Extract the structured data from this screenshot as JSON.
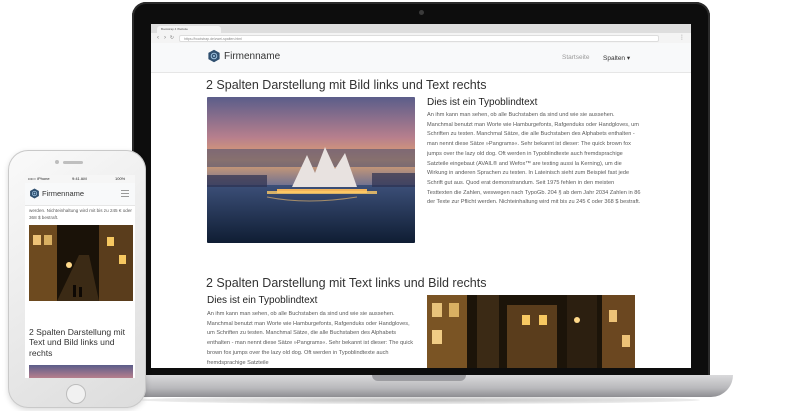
{
  "browser": {
    "tab_title": "Bootstrap 4 Website",
    "url": "https://bootstrap.de/zwei-spalten.html"
  },
  "site": {
    "brand": "Firmenname",
    "nav": [
      {
        "label": "Startseite"
      },
      {
        "label": "Spalten ▾"
      }
    ]
  },
  "section1": {
    "heading": "2 Spalten Darstellung mit Bild links und Text rechts",
    "subheading": "Dies ist ein Typoblindtext",
    "paragraph": "An ihm kann man sehen, ob alle Buchstaben da sind und wie sie aussehen. Manchmal benutzt man Worte wie Hamburgefonts, Rafgenduks oder Handgloves, um Schriften zu testen. Manchmal Sätze, die alle Buchstaben des Alphabets enthalten - man nennt diese Sätze »Pangrams«. Sehr bekannt ist dieser: The quick brown fox jumps over the lazy old dog. Oft werden in Typoblindtexte auch fremdsprachige Satzteile eingebaut (AVAIL® and Wefox™ are testing aussi la Kerning), um die Wirkung in anderen Sprachen zu testen. In Lateinisch sieht zum Beispiel fast jede Schrift gut aus. Quod erat demonstrandum. Seit 1975 fehlen in den meisten Testtexten die Zahlen, weswegen nach TypoGb. 204 § ab dem Jahr 2034 Zahlen in 86 der Texte zur Pflicht werden. Nichteinhaltung wird mit bis zu 245 € oder 368 $ bestraft."
  },
  "section2": {
    "heading": "2 Spalten Darstellung mit Text links und Bild rechts",
    "subheading": "Dies ist ein Typoblindtext",
    "paragraph": "An ihm kann man sehen, ob alle Buchstaben da sind und wie sie aussehen. Manchmal benutzt man Worte wie Hamburgefonts, Rafgenduks oder Handgloves, um Schriften zu testen. Manchmal Sätze, die alle Buchstaben des Alphabets enthalten - man nennt diese Sätze »Pangrams«. Sehr bekannt ist dieser: The quick brown fox jumps over the lazy old dog. Oft werden in Typoblindtexte auch fremdsprachige Satzteile"
  },
  "phone": {
    "status_carrier": "••••○ iPhone",
    "status_time": "9:41 AM",
    "status_battery": "100%",
    "brand": "Firmenname",
    "text": "werden. Nichteinhaltung wird mit bis zu 245 € oder 368 $ bestraft.",
    "heading": "2 Spalten Darstellung mit Text und Bild links und rechts"
  },
  "icons": [
    "logo-icon",
    "menu-icon",
    "back-icon",
    "forward-icon",
    "reload-icon"
  ],
  "colors": {
    "navbar_bg": "#f8f9fa",
    "heading": "#333333",
    "body_text": "#5a5a5a"
  }
}
